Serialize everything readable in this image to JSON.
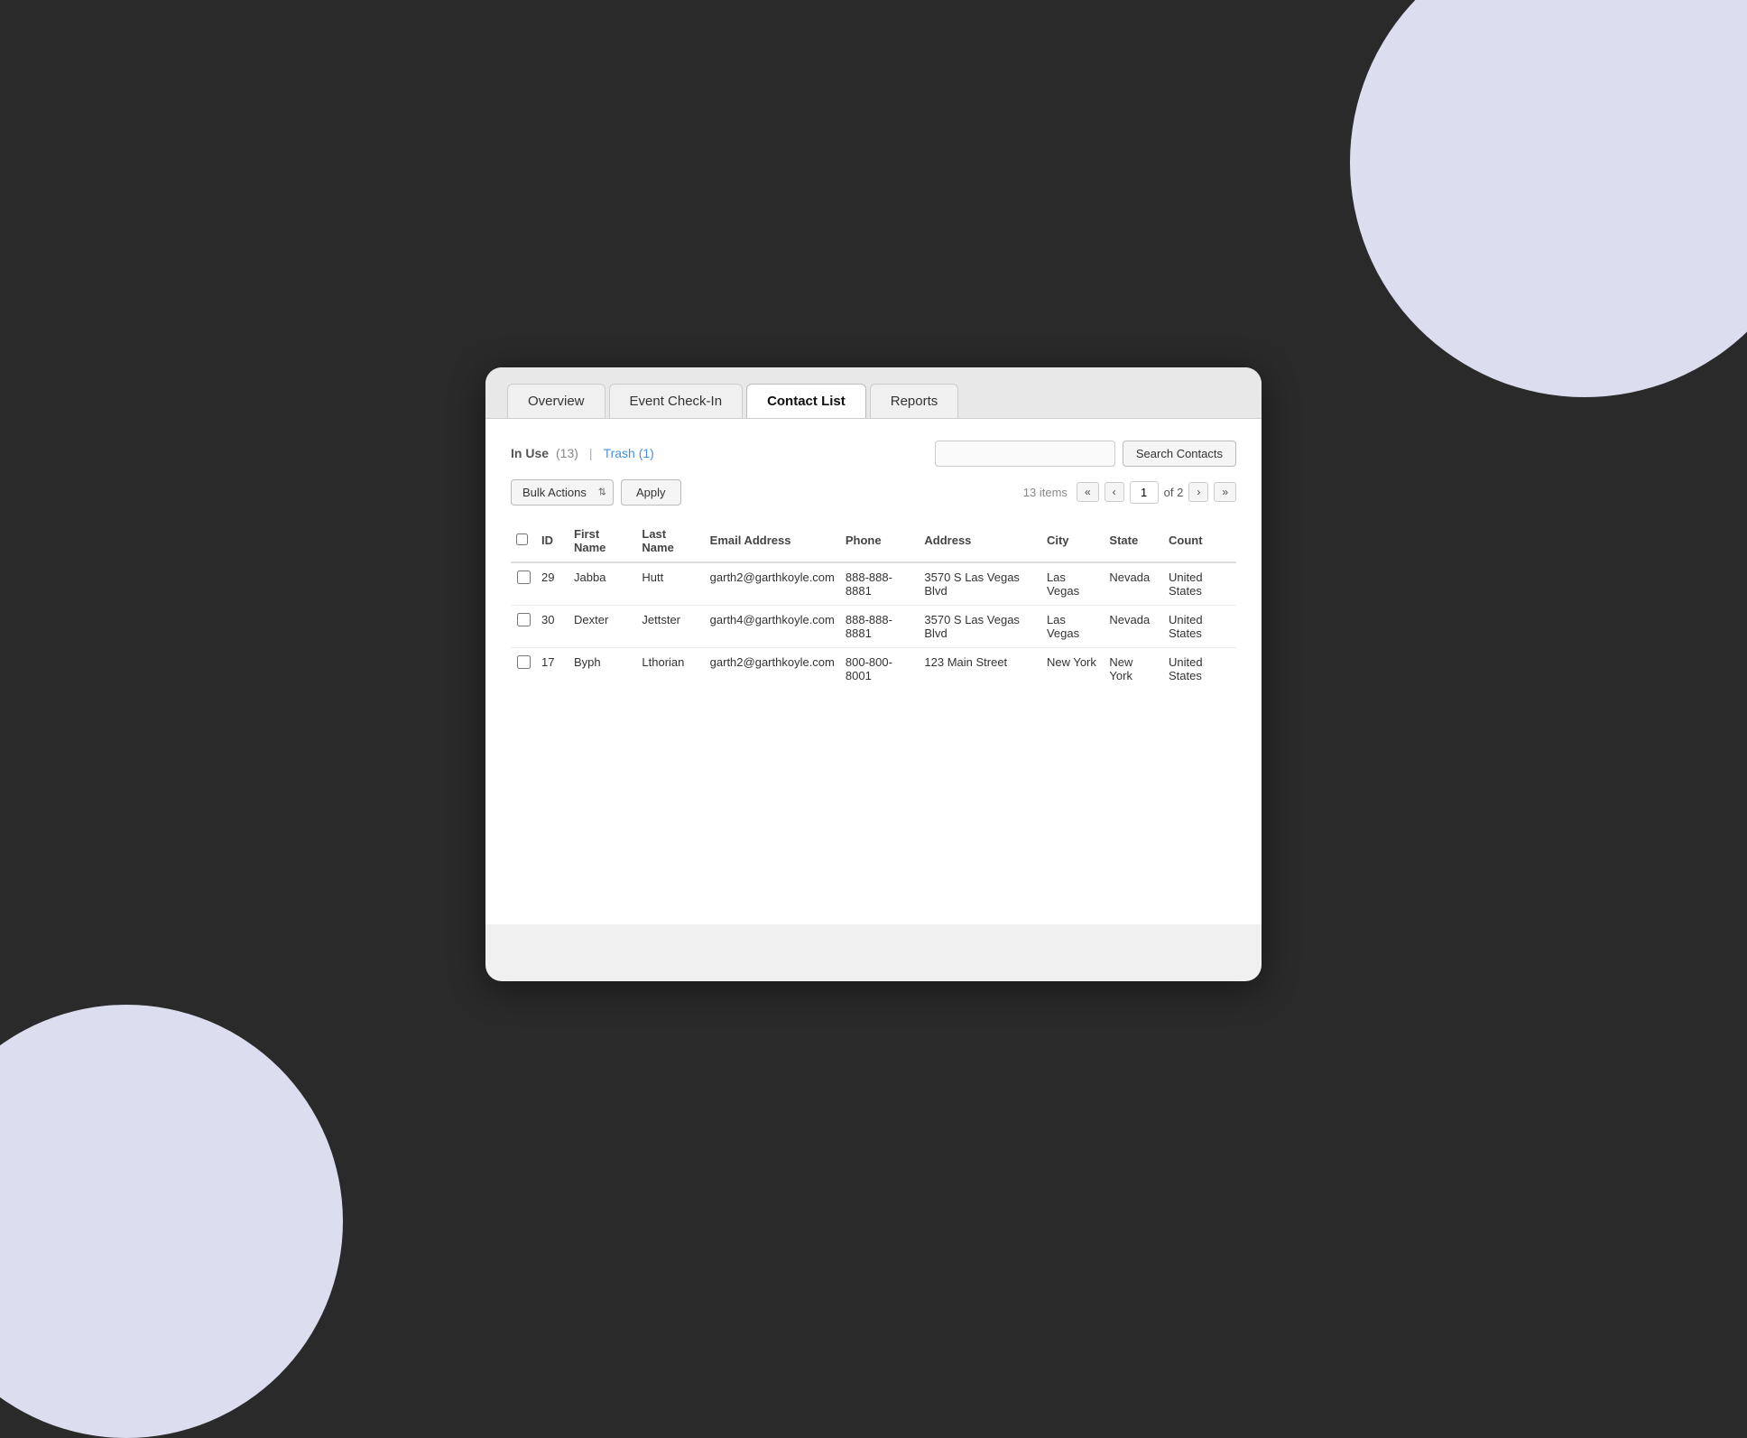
{
  "background": {
    "circle_color": "#ddddf0"
  },
  "tabs": [
    {
      "id": "overview",
      "label": "Overview",
      "active": false
    },
    {
      "id": "event-checkin",
      "label": "Event Check-In",
      "active": false
    },
    {
      "id": "contact-list",
      "label": "Contact List",
      "active": true
    },
    {
      "id": "reports",
      "label": "Reports",
      "active": false
    }
  ],
  "filter": {
    "in_use_label": "In Use",
    "in_use_count": "(13)",
    "separator": "|",
    "trash_label": "Trash",
    "trash_count": "(1)"
  },
  "search": {
    "placeholder": "",
    "button_label": "Search Contacts"
  },
  "toolbar": {
    "bulk_actions_label": "Bulk Actions",
    "apply_label": "Apply",
    "items_count": "13 items",
    "page_current": "1",
    "page_of": "of 2"
  },
  "table": {
    "headers": [
      {
        "id": "checkbox",
        "label": ""
      },
      {
        "id": "id",
        "label": "ID"
      },
      {
        "id": "first_name",
        "label": "First Name"
      },
      {
        "id": "last_name",
        "label": "Last Name"
      },
      {
        "id": "email",
        "label": "Email Address"
      },
      {
        "id": "phone",
        "label": "Phone"
      },
      {
        "id": "address",
        "label": "Address"
      },
      {
        "id": "city",
        "label": "City"
      },
      {
        "id": "state",
        "label": "State"
      },
      {
        "id": "country",
        "label": "Count"
      }
    ],
    "rows": [
      {
        "id": "29",
        "first_name": "Jabba",
        "last_name": "Hutt",
        "email": "garth2@garthkoyle.com",
        "phone": "888-888-8881",
        "address": "3570 S Las Vegas Blvd",
        "city": "Las Vegas",
        "state": "Nevada",
        "country": "United States"
      },
      {
        "id": "30",
        "first_name": "Dexter",
        "last_name": "Jettster",
        "email": "garth4@garthkoyle.com",
        "phone": "888-888-8881",
        "address": "3570 S Las Vegas Blvd",
        "city": "Las Vegas",
        "state": "Nevada",
        "country": "United States"
      },
      {
        "id": "17",
        "first_name": "Byph",
        "last_name": "Lthorian",
        "email": "garth2@garthkoyle.com",
        "phone": "800-800-8001",
        "address": "123 Main Street",
        "city": "New York",
        "state": "New York",
        "country": "United States"
      }
    ]
  }
}
